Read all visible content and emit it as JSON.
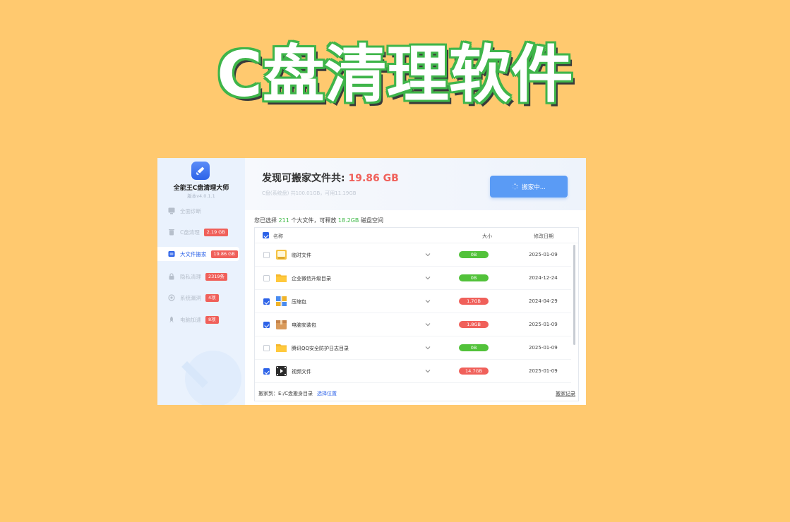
{
  "poster": {
    "title": "C盘清理软件"
  },
  "app": {
    "name": "全能王C盘清理大师",
    "version": "版本v4.0.1.1"
  },
  "sidebar": {
    "items": [
      {
        "label": "全面诊断",
        "icon": "monitor-icon",
        "badge": ""
      },
      {
        "label": "C盘清理",
        "icon": "trash-icon",
        "badge": "2.19 GB"
      },
      {
        "label": "大文件搬家",
        "icon": "folder-move-icon",
        "badge": "19.86 GB",
        "active": true
      },
      {
        "label": "隐私清理",
        "icon": "lock-icon",
        "badge": "2319条"
      },
      {
        "label": "系统漏洞",
        "icon": "shield-scan-icon",
        "badge": "4项"
      },
      {
        "label": "电脑加速",
        "icon": "rocket-icon",
        "badge": "8项"
      }
    ]
  },
  "header": {
    "title_prefix": "发现可搬家文件共: ",
    "title_size": "19.86 GB",
    "subline": "C盘(系统盘) 共100.01GB，可用11.19GB",
    "scan_button": "搬家中..."
  },
  "summary": {
    "part1": "您已选择 ",
    "count": "211",
    "part2": " 个大文件，可释放 ",
    "size": "18.2GB",
    "part3": " 磁盘空间"
  },
  "table": {
    "columns": {
      "name": "名称",
      "size": "大小",
      "date": "修改日期"
    },
    "rows": [
      {
        "name": "临时文件",
        "size": "0B",
        "date": "2025-01-09",
        "checked": false,
        "icon": "temp-file-icon",
        "level": "green"
      },
      {
        "name": "企业微信升级目录",
        "size": "0B",
        "date": "2024-12-24",
        "checked": false,
        "icon": "folder-icon",
        "level": "green"
      },
      {
        "name": "压缩包",
        "size": "1.7GB",
        "date": "2024-04-29",
        "checked": true,
        "icon": "archive-icon",
        "level": "red"
      },
      {
        "name": "电脑安装包",
        "size": "1.8GB",
        "date": "2025-01-09",
        "checked": true,
        "icon": "package-icon",
        "level": "red"
      },
      {
        "name": "腾讯QQ安全防护日志目录",
        "size": "0B",
        "date": "2025-01-09",
        "checked": false,
        "icon": "folder-icon",
        "level": "green"
      },
      {
        "name": "视频文件",
        "size": "14.7GB",
        "date": "2025-01-09",
        "checked": true,
        "icon": "video-file-icon",
        "level": "red"
      }
    ]
  },
  "footer": {
    "target": "搬家到：E:/C盘搬身目录",
    "choose": "选择位置",
    "history": "搬家记录"
  },
  "colors": {
    "background": "#ffc96f",
    "title_outline": "#3fb54a",
    "accent": "#2d63e8",
    "danger": "#f0605a",
    "ok": "#52c23a"
  }
}
